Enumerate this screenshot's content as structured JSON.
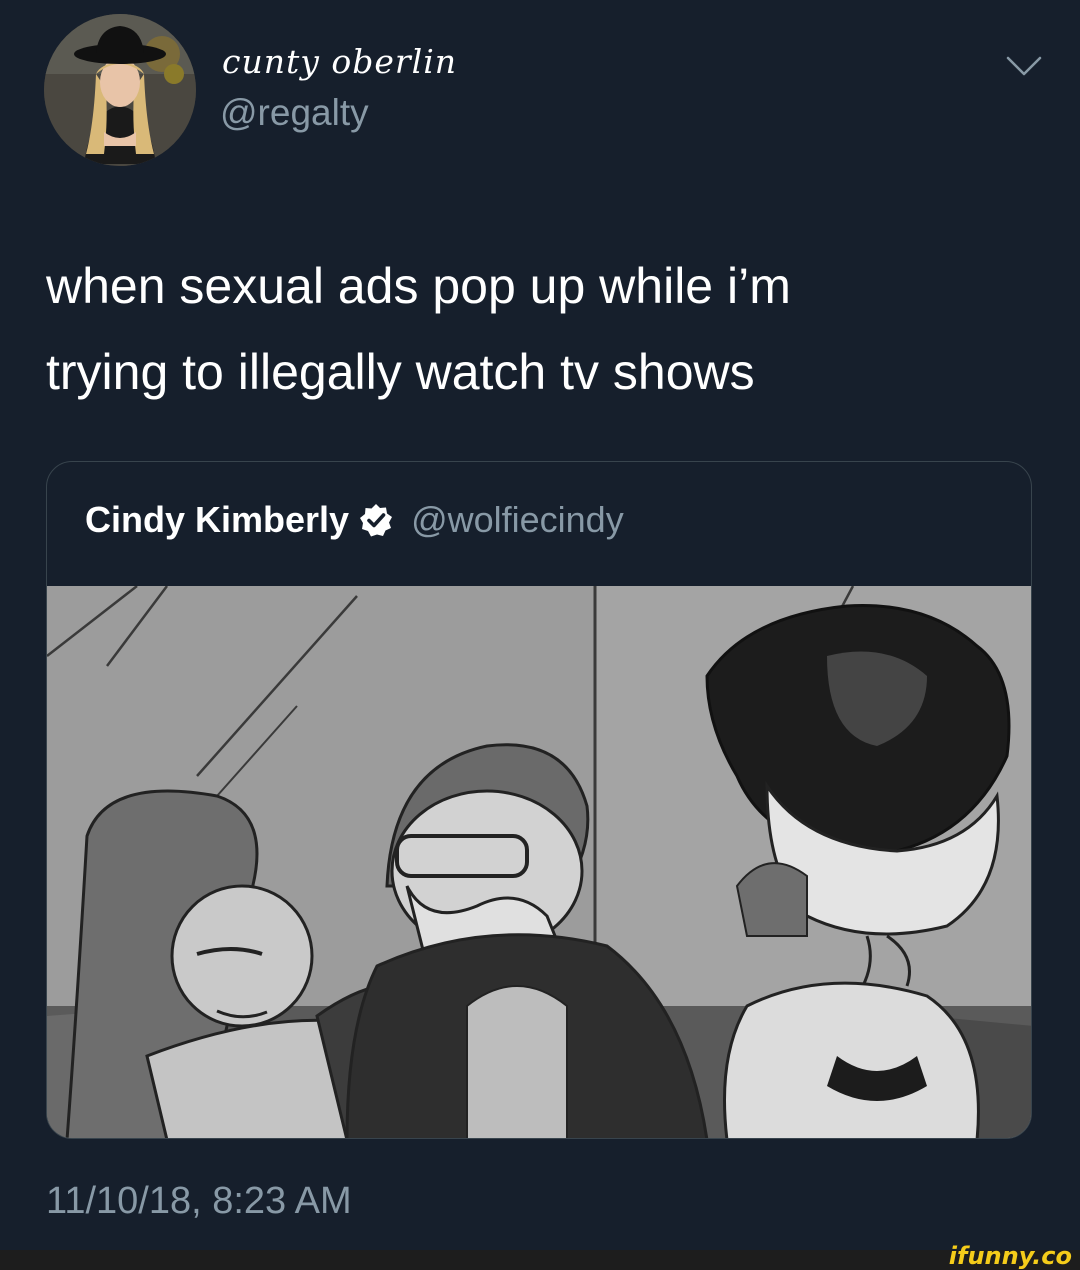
{
  "tweet": {
    "author": {
      "display_name": "cunty oberlin",
      "handle": "@regalty",
      "avatar_icon": "profile-photo"
    },
    "menu_icon": "chevron-down-icon",
    "text_lines": [
      "when sexual ads pop up while i’m",
      "trying to illegally watch tv shows"
    ],
    "timestamp": "11/10/18, 8:23 AM"
  },
  "quoted_tweet": {
    "author_name": "Cindy Kimberly",
    "verified": true,
    "verified_icon": "verified-badge-icon",
    "handle": "@wolfiecindy",
    "media_icon": "cartoon-image"
  },
  "watermark": "ifunny.co",
  "colors": {
    "background": "#15202b",
    "text_primary": "#ffffff",
    "text_secondary": "#8899a6",
    "border": "#38444d",
    "watermark": "#f5cc1a"
  }
}
